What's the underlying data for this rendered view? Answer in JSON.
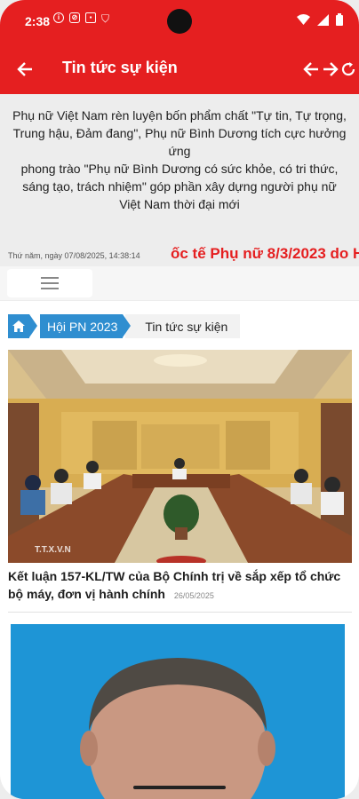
{
  "status_bar": {
    "time": "2:38",
    "icons": [
      "info-circle-icon",
      "vpn-shield-icon",
      "screenshot-icon",
      "shield-icon"
    ],
    "right_icons": [
      "wifi-icon",
      "signal-icon",
      "battery-icon"
    ]
  },
  "app_bar": {
    "title": "Tin tức sự kiện",
    "icons": [
      "arrow-left-icon",
      "arrow-left-icon",
      "arrow-right-icon",
      "refresh-icon"
    ]
  },
  "banner": {
    "line1": "Phụ nữ Việt Nam rèn luyện bốn phẩm chất \"Tự tin, Tự trọng, Trung hậu, Đảm đang\", Phụ nữ Bình Dương tích cực hưởng ứng",
    "line2": "phong trào \"Phụ nữ Bình Dương có sức khỏe, có tri thức, sáng tạo, trách nhiệm\" góp phần xây dựng người phụ nữ Việt Nam thời đại mới"
  },
  "date_row": {
    "date": "Thứ năm, ngày 07/08/2025, 14:38:14",
    "marquee": "ốc tế Phụ nữ 8/3/2023 do H"
  },
  "menu": {
    "icon": "hamburger-menu-icon"
  },
  "breadcrumb": {
    "home_icon": "home-icon",
    "section": "Hội PN 2023",
    "current": "Tin tức sự kiện"
  },
  "articles": [
    {
      "title": "Kết luận 157-KL/TW của Bộ Chính trị về sắp xếp tổ chức bộ máy, đơn vị hành chính",
      "date": "26/05/2025",
      "watermark": "T.T.X.V.N"
    }
  ],
  "colors": {
    "primary": "#e51f20",
    "breadcrumb": "#2f8ed0",
    "marquee": "#e51f20"
  }
}
